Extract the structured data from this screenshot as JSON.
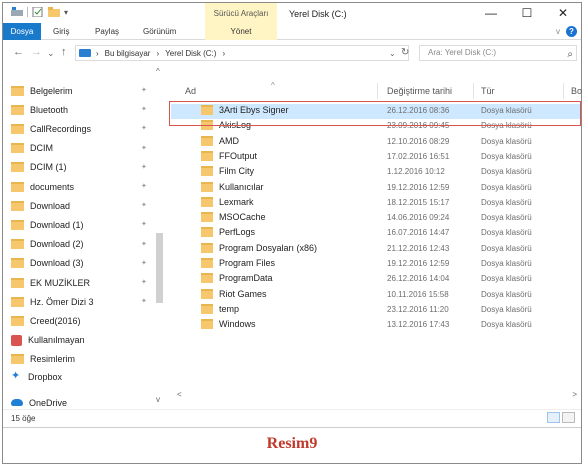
{
  "titlebar": {
    "context_tool_label": "Sürücü Araçları",
    "window_title": "Yerel Disk (C:)",
    "minimize": "—",
    "maximize": "☐",
    "close": "✕"
  },
  "ribbon": {
    "tabs": [
      {
        "label": "Dosya",
        "active": true
      },
      {
        "label": "Giriş"
      },
      {
        "label": "Paylaş"
      },
      {
        "label": "Görünüm"
      },
      {
        "label": "Yönet",
        "contextual": true
      }
    ],
    "help_label": "?",
    "collapse_label": "v"
  },
  "address": {
    "back": "←",
    "forward": "→",
    "history": "⌄",
    "up": "↑",
    "crumbs": [
      "Bu bilgisayar",
      "Yerel Disk (C:)"
    ],
    "separator": "›",
    "search_placeholder": "Ara: Yerel Disk (C:)"
  },
  "navpane": {
    "items": [
      {
        "label": "Belgelerim",
        "pinned": true
      },
      {
        "label": "Bluetooth",
        "pinned": true
      },
      {
        "label": "CallRecordings",
        "pinned": true
      },
      {
        "label": "DCIM",
        "pinned": true
      },
      {
        "label": "DCIM (1)",
        "pinned": true
      },
      {
        "label": "documents",
        "pinned": true
      },
      {
        "label": "Download",
        "pinned": true
      },
      {
        "label": "Download (1)",
        "pinned": true
      },
      {
        "label": "Download (2)",
        "pinned": true
      },
      {
        "label": "Download (3)",
        "pinned": true
      },
      {
        "label": "EK MUZİKLER",
        "pinned": true
      },
      {
        "label": "Hz. Ömer Dizi 3",
        "pinned": true
      },
      {
        "label": "Creed(2016)"
      },
      {
        "label": "Kullanılmayan",
        "special": "red"
      },
      {
        "label": "Resimlerim"
      },
      {
        "label": "Dropbox",
        "special": "dropbox"
      },
      {
        "label": "OneDrive",
        "special": "onedrive"
      }
    ],
    "pin_glyph": "✦"
  },
  "filelist": {
    "columns": {
      "name": "Ad",
      "date": "Değiştirme tarihi",
      "type": "Tür",
      "size": "Bo"
    },
    "rows": [
      {
        "name": "3Arti Ebys Signer",
        "date": "26.12.2016 08:36",
        "type": "Dosya klasörü",
        "selected": true
      },
      {
        "name": "AkisLog",
        "date": "23.09.2016 09:45",
        "type": "Dosya klasörü"
      },
      {
        "name": "AMD",
        "date": "12.10.2016 08:29",
        "type": "Dosya klasörü"
      },
      {
        "name": "FFOutput",
        "date": "17.02.2016 16:51",
        "type": "Dosya klasörü"
      },
      {
        "name": "Film City",
        "date": "1.12.2016 10:12",
        "type": "Dosya klasörü"
      },
      {
        "name": "Kullanıcılar",
        "date": "19.12.2016 12:59",
        "type": "Dosya klasörü"
      },
      {
        "name": "Lexmark",
        "date": "18.12.2015 15:17",
        "type": "Dosya klasörü"
      },
      {
        "name": "MSOCache",
        "date": "14.06.2016 09:24",
        "type": "Dosya klasörü"
      },
      {
        "name": "PerfLogs",
        "date": "16.07.2016 14:47",
        "type": "Dosya klasörü"
      },
      {
        "name": "Program Dosyaları (x86)",
        "date": "21.12.2016 12:43",
        "type": "Dosya klasörü"
      },
      {
        "name": "Program Files",
        "date": "19.12.2016 12:59",
        "type": "Dosya klasörü"
      },
      {
        "name": "ProgramData",
        "date": "26.12.2016 14:04",
        "type": "Dosya klasörü"
      },
      {
        "name": "Riot Games",
        "date": "10.11.2016 15:58",
        "type": "Dosya klasörü"
      },
      {
        "name": "temp",
        "date": "23.12.2016 11:20",
        "type": "Dosya klasörü"
      },
      {
        "name": "Windows",
        "date": "13.12.2016 17:43",
        "type": "Dosya klasörü"
      }
    ]
  },
  "status": {
    "item_count": "15 öğe"
  },
  "caption": "Resim9",
  "colors": {
    "accent": "#1979ca",
    "context_tab": "#fff4c4",
    "folder": "#f6c76c",
    "selection": "#cde8ff",
    "highlight": "#d9534f",
    "caption": "#c0392b"
  }
}
